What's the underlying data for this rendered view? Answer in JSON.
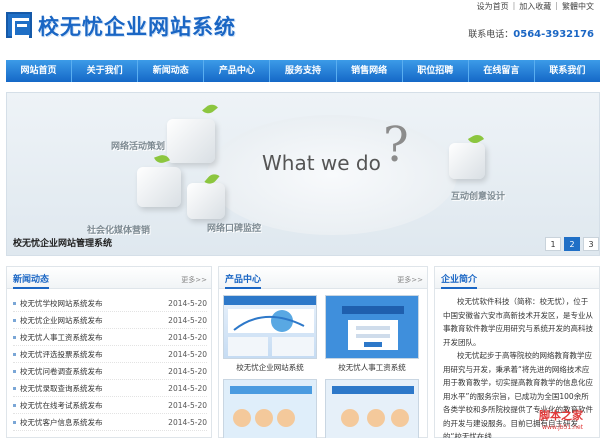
{
  "header": {
    "site_title": "校无忧企业网站系统",
    "top_links": [
      "设为首页",
      "加入收藏",
      "繁體中文"
    ],
    "hotline_label": "联系电话：",
    "hotline_number": "0564-3932176"
  },
  "nav": {
    "items": [
      "网站首页",
      "关于我们",
      "新闻动态",
      "产品中心",
      "服务支持",
      "销售网络",
      "职位招聘",
      "在线留言",
      "联系我们"
    ]
  },
  "banner": {
    "headline": "What we do",
    "qmark": "?",
    "labels": [
      "网络活动策划",
      "社会化媒体营销",
      "网络口碑监控",
      "互动创意设计"
    ],
    "caption": "校无忧企业网站管理系统",
    "pages": [
      "1",
      "2",
      "3"
    ],
    "active_page": "2"
  },
  "news": {
    "title": "新闻动态",
    "more": "更多>>",
    "items": [
      {
        "title": "校无忧学校网站系统发布",
        "date": "2014-5-20"
      },
      {
        "title": "校无忧企业网站系统发布",
        "date": "2014-5-20"
      },
      {
        "title": "校无忧人事工资系统发布",
        "date": "2014-5-20"
      },
      {
        "title": "校无忧评选投票系统发布",
        "date": "2014-5-20"
      },
      {
        "title": "校无忧问卷调查系统发布",
        "date": "2014-5-20"
      },
      {
        "title": "校无忧录取查询系统发布",
        "date": "2014-5-20"
      },
      {
        "title": "校无忧在线考试系统发布",
        "date": "2014-5-20"
      },
      {
        "title": "校无忧客户信息系统发布",
        "date": "2014-5-20"
      }
    ]
  },
  "products": {
    "title": "产品中心",
    "more": "更多>>",
    "items": [
      {
        "name": "校无忧企业网站系统"
      },
      {
        "name": "校无忧人事工资系统"
      }
    ]
  },
  "about": {
    "title": "企业简介",
    "paragraphs": [
      "校无忧软件科技（简称：校无忧），位于中国安徽省六安市高新技术开发区，是专业从事教育软件教学应用研究与系统开发的高科技开发团队。",
      "校无忧起步于高等院校的网络教育教学应用研究与开发，秉承着“将先进的网络技术应用于教育教学，切实提高教育教学的信息化应用水平”的服务宗旨，已成功为全国100余所各类学校和多所院校提供了专业化的教育软件的开发与建设服务。目前已拥有自主研发的“校无忧在线"
    ],
    "watermark": "脚本之家",
    "watermark_sub": "www.jb51.net"
  },
  "colors": {
    "brand_blue": "#1a66c4",
    "nav_top": "#3c9be8",
    "nav_bottom": "#1568c7",
    "watermark_red": "#e13a3a"
  }
}
